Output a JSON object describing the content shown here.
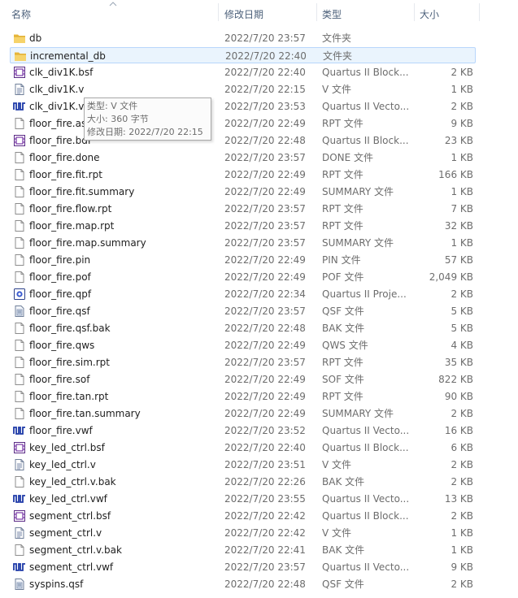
{
  "columns": {
    "name": "名称",
    "date": "修改日期",
    "type": "类型",
    "size": "大小"
  },
  "files": [
    {
      "name": "db",
      "date": "2022/7/20 23:57",
      "type": "文件夹",
      "size": "",
      "icon": "folder-icon"
    },
    {
      "name": "incremental_db",
      "date": "2022/7/20 22:40",
      "type": "文件夹",
      "size": "",
      "icon": "folder-icon",
      "selected": true
    },
    {
      "name": "clk_div1K.bsf",
      "date": "2022/7/20 22:40",
      "type": "Quartus II Block...",
      "size": "2 KB",
      "icon": "block-file-icon"
    },
    {
      "name": "clk_div1K.v",
      "date": "2022/7/20 22:15",
      "type": "V 文件",
      "size": "1 KB",
      "icon": "text-file-icon"
    },
    {
      "name": "clk_div1K.vwf",
      "date": "2022/7/20 23:53",
      "type": "Quartus II Vecto...",
      "size": "2 KB",
      "icon": "waveform-file-icon"
    },
    {
      "name": "floor_fire.asm.rpt",
      "date": "2022/7/20 22:49",
      "type": "RPT 文件",
      "size": "9 KB",
      "icon": "blank-file-icon"
    },
    {
      "name": "floor_fire.bdf",
      "date": "2022/7/20 22:48",
      "type": "Quartus II Block...",
      "size": "23 KB",
      "icon": "block-file-icon"
    },
    {
      "name": "floor_fire.done",
      "date": "2022/7/20 23:57",
      "type": "DONE 文件",
      "size": "1 KB",
      "icon": "blank-file-icon"
    },
    {
      "name": "floor_fire.fit.rpt",
      "date": "2022/7/20 22:49",
      "type": "RPT 文件",
      "size": "166 KB",
      "icon": "blank-file-icon"
    },
    {
      "name": "floor_fire.fit.summary",
      "date": "2022/7/20 22:49",
      "type": "SUMMARY 文件",
      "size": "1 KB",
      "icon": "blank-file-icon"
    },
    {
      "name": "floor_fire.flow.rpt",
      "date": "2022/7/20 23:57",
      "type": "RPT 文件",
      "size": "7 KB",
      "icon": "blank-file-icon"
    },
    {
      "name": "floor_fire.map.rpt",
      "date": "2022/7/20 23:57",
      "type": "RPT 文件",
      "size": "32 KB",
      "icon": "blank-file-icon"
    },
    {
      "name": "floor_fire.map.summary",
      "date": "2022/7/20 23:57",
      "type": "SUMMARY 文件",
      "size": "1 KB",
      "icon": "blank-file-icon"
    },
    {
      "name": "floor_fire.pin",
      "date": "2022/7/20 22:49",
      "type": "PIN 文件",
      "size": "57 KB",
      "icon": "blank-file-icon"
    },
    {
      "name": "floor_fire.pof",
      "date": "2022/7/20 22:49",
      "type": "POF 文件",
      "size": "2,049 KB",
      "icon": "blank-file-icon"
    },
    {
      "name": "floor_fire.qpf",
      "date": "2022/7/20 22:34",
      "type": "Quartus II Proje...",
      "size": "2 KB",
      "icon": "project-file-icon"
    },
    {
      "name": "floor_fire.qsf",
      "date": "2022/7/20 23:57",
      "type": "QSF 文件",
      "size": "5 KB",
      "icon": "settings-file-icon"
    },
    {
      "name": "floor_fire.qsf.bak",
      "date": "2022/7/20 22:48",
      "type": "BAK 文件",
      "size": "5 KB",
      "icon": "blank-file-icon"
    },
    {
      "name": "floor_fire.qws",
      "date": "2022/7/20 22:49",
      "type": "QWS 文件",
      "size": "4 KB",
      "icon": "blank-file-icon"
    },
    {
      "name": "floor_fire.sim.rpt",
      "date": "2022/7/20 23:57",
      "type": "RPT 文件",
      "size": "35 KB",
      "icon": "blank-file-icon"
    },
    {
      "name": "floor_fire.sof",
      "date": "2022/7/20 22:49",
      "type": "SOF 文件",
      "size": "822 KB",
      "icon": "blank-file-icon"
    },
    {
      "name": "floor_fire.tan.rpt",
      "date": "2022/7/20 22:49",
      "type": "RPT 文件",
      "size": "90 KB",
      "icon": "blank-file-icon"
    },
    {
      "name": "floor_fire.tan.summary",
      "date": "2022/7/20 22:49",
      "type": "SUMMARY 文件",
      "size": "2 KB",
      "icon": "blank-file-icon"
    },
    {
      "name": "floor_fire.vwf",
      "date": "2022/7/20 23:52",
      "type": "Quartus II Vecto...",
      "size": "16 KB",
      "icon": "waveform-file-icon"
    },
    {
      "name": "key_led_ctrl.bsf",
      "date": "2022/7/20 22:40",
      "type": "Quartus II Block...",
      "size": "6 KB",
      "icon": "block-file-icon"
    },
    {
      "name": "key_led_ctrl.v",
      "date": "2022/7/20 23:51",
      "type": "V 文件",
      "size": "2 KB",
      "icon": "text-file-icon"
    },
    {
      "name": "key_led_ctrl.v.bak",
      "date": "2022/7/20 22:26",
      "type": "BAK 文件",
      "size": "2 KB",
      "icon": "blank-file-icon"
    },
    {
      "name": "key_led_ctrl.vwf",
      "date": "2022/7/20 23:55",
      "type": "Quartus II Vecto...",
      "size": "13 KB",
      "icon": "waveform-file-icon"
    },
    {
      "name": "segment_ctrl.bsf",
      "date": "2022/7/20 22:42",
      "type": "Quartus II Block...",
      "size": "2 KB",
      "icon": "block-file-icon"
    },
    {
      "name": "segment_ctrl.v",
      "date": "2022/7/20 22:42",
      "type": "V 文件",
      "size": "1 KB",
      "icon": "text-file-icon"
    },
    {
      "name": "segment_ctrl.v.bak",
      "date": "2022/7/20 22:41",
      "type": "BAK 文件",
      "size": "1 KB",
      "icon": "blank-file-icon"
    },
    {
      "name": "segment_ctrl.vwf",
      "date": "2022/7/20 23:57",
      "type": "Quartus II Vecto...",
      "size": "9 KB",
      "icon": "waveform-file-icon"
    },
    {
      "name": "syspins.qsf",
      "date": "2022/7/20 22:48",
      "type": "QSF 文件",
      "size": "2 KB",
      "icon": "settings-file-icon"
    }
  ],
  "tooltip": {
    "type_line": "类型: V 文件",
    "size_line": "大小: 360 字节",
    "date_line": "修改日期: 2022/7/20 22:15"
  },
  "colors": {
    "selection_bg": "#eaf4fd",
    "selection_border": "#b8d6fb",
    "folder": "#f0c24a",
    "header_text": "#4c607a",
    "detail_text": "#6d6d6d"
  }
}
